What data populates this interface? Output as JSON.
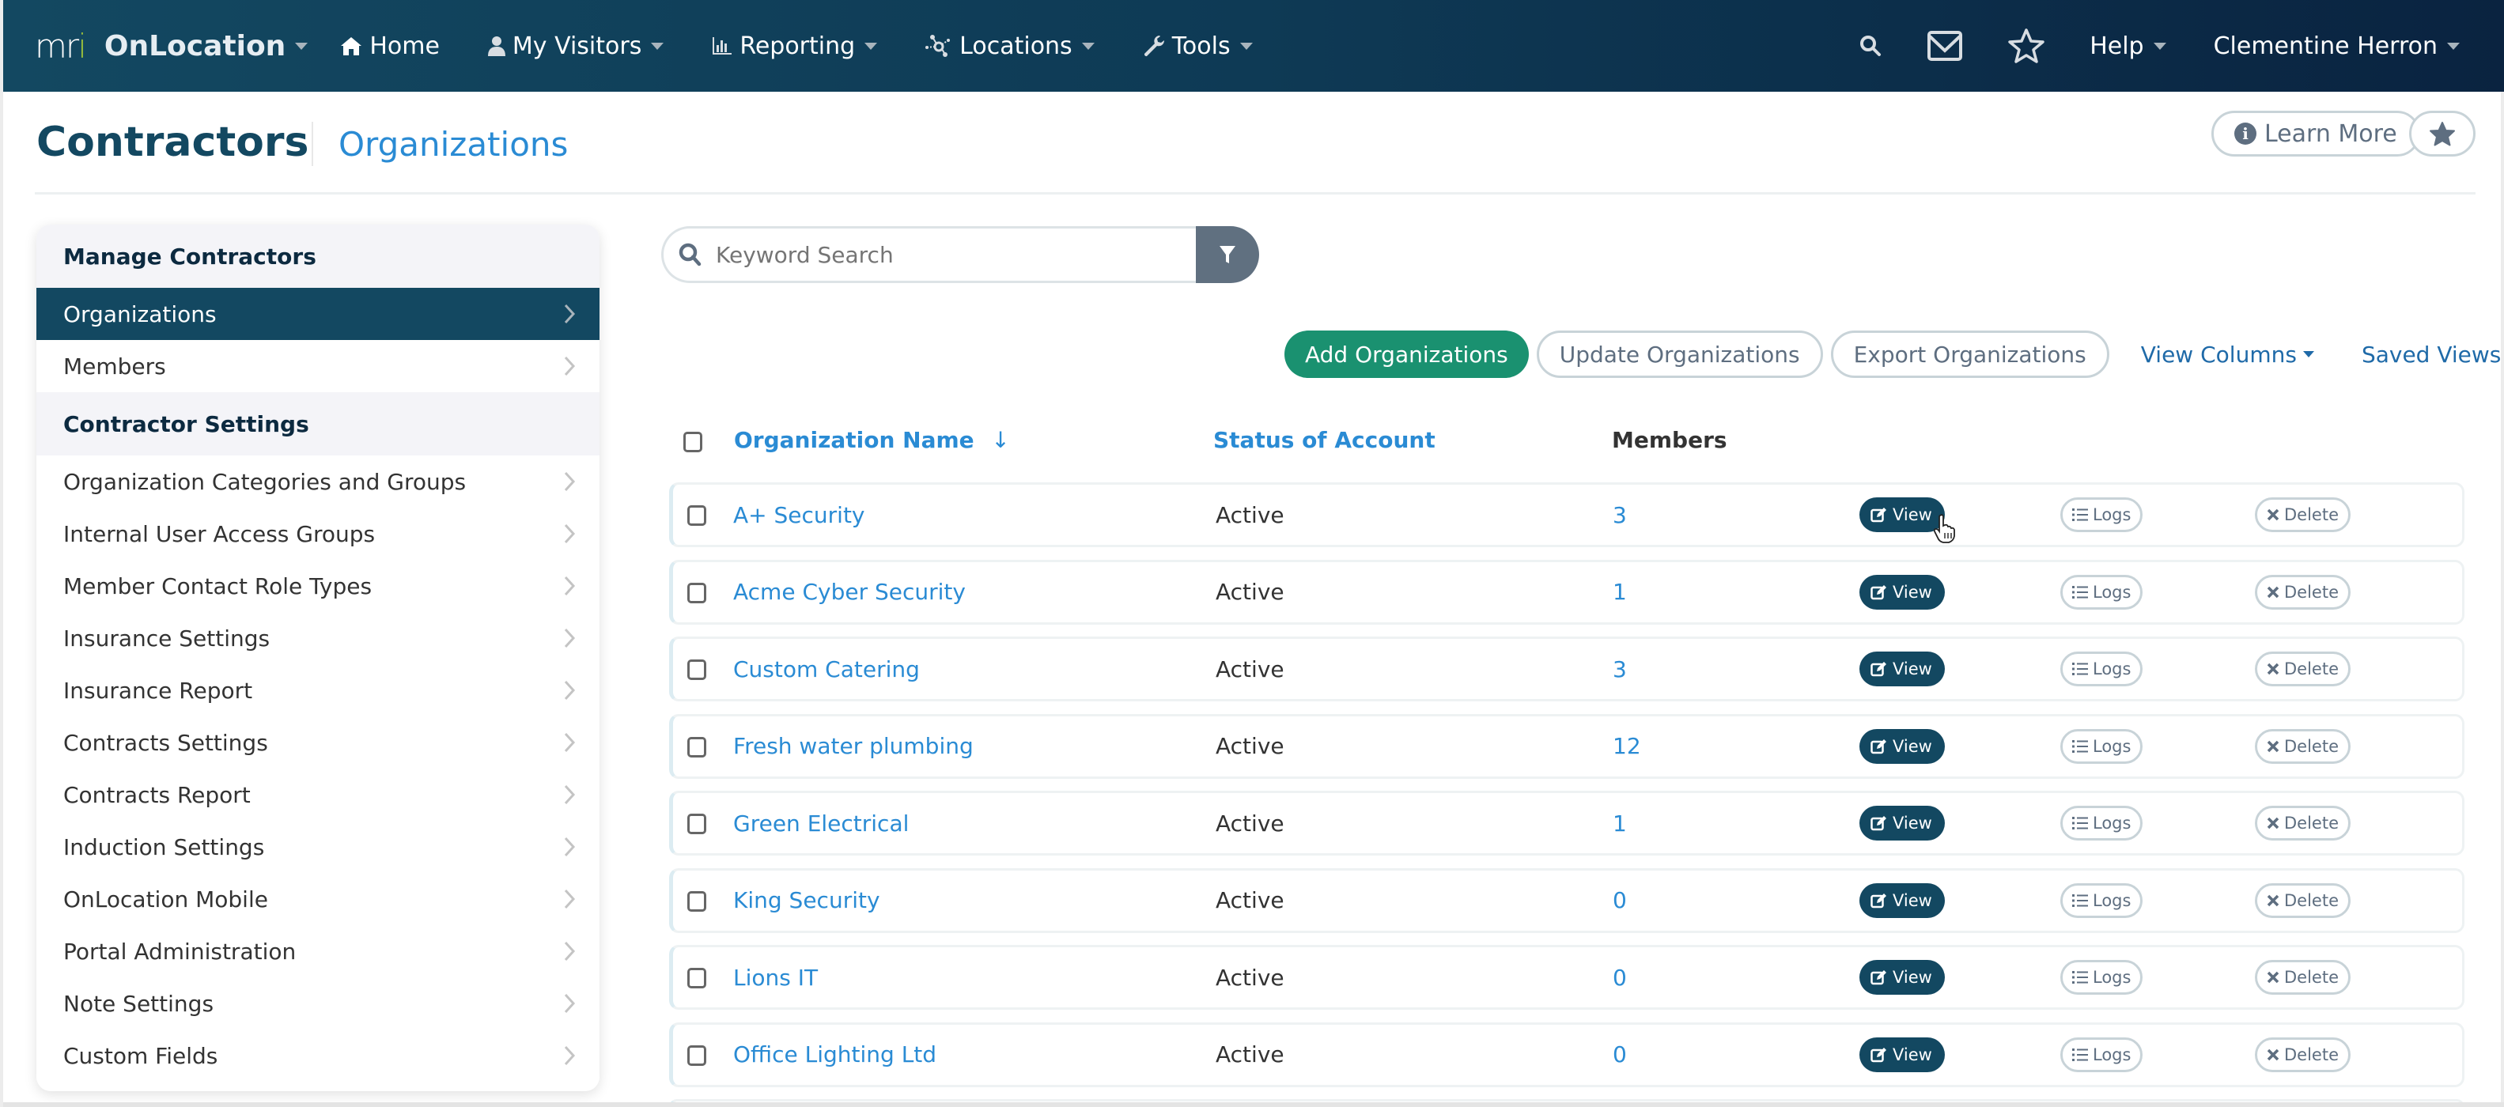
{
  "topnav": {
    "brand_logo": "mri",
    "brand_name": "OnLocation",
    "items": [
      {
        "label": "Home",
        "icon": "home-icon",
        "has_caret": false
      },
      {
        "label": "My Visitors",
        "icon": "user-icon",
        "has_caret": true
      },
      {
        "label": "Reporting",
        "icon": "bar-chart-icon",
        "has_caret": true
      },
      {
        "label": "Locations",
        "icon": "network-icon",
        "has_caret": true
      },
      {
        "label": "Tools",
        "icon": "wrench-icon",
        "has_caret": true
      }
    ],
    "help_label": "Help",
    "user_name": "Clementine Herron"
  },
  "header": {
    "title": "Contractors",
    "subtitle": "Organizations",
    "learn_more_label": "Learn More",
    "info_glyph": "i"
  },
  "sidebar": {
    "section1_title": "Manage Contractors",
    "section1_items": [
      {
        "label": "Organizations",
        "active": true
      },
      {
        "label": "Members",
        "active": false
      }
    ],
    "section2_title": "Contractor Settings",
    "section2_items": [
      {
        "label": "Organization Categories and Groups"
      },
      {
        "label": "Internal User Access Groups"
      },
      {
        "label": "Member Contact Role Types"
      },
      {
        "label": "Insurance Settings"
      },
      {
        "label": "Insurance Report"
      },
      {
        "label": "Contracts Settings"
      },
      {
        "label": "Contracts Report"
      },
      {
        "label": "Induction Settings"
      },
      {
        "label": "OnLocation Mobile"
      },
      {
        "label": "Portal Administration"
      },
      {
        "label": "Note Settings"
      },
      {
        "label": "Custom Fields"
      }
    ]
  },
  "search": {
    "placeholder": "Keyword Search",
    "value": ""
  },
  "actions": {
    "add_label": "Add Organizations",
    "update_label": "Update Organizations",
    "export_label": "Export Organizations",
    "view_columns_label": "View Columns",
    "saved_views_label": "Saved Views"
  },
  "table": {
    "columns": {
      "name": "Organization Name",
      "sort_indicator": "↓",
      "status": "Status of Account",
      "members": "Members"
    },
    "row_actions": {
      "view": "View",
      "logs": "Logs",
      "delete": "Delete"
    },
    "rows": [
      {
        "name": "A+ Security",
        "status": "Active",
        "members": "3"
      },
      {
        "name": "Acme Cyber Security",
        "status": "Active",
        "members": "1"
      },
      {
        "name": "Custom Catering",
        "status": "Active",
        "members": "3"
      },
      {
        "name": "Fresh water plumbing",
        "status": "Active",
        "members": "12"
      },
      {
        "name": "Green Electrical",
        "status": "Active",
        "members": "1"
      },
      {
        "name": "King Security",
        "status": "Active",
        "members": "0"
      },
      {
        "name": "Lions IT",
        "status": "Active",
        "members": "0"
      },
      {
        "name": "Office Lighting Ltd",
        "status": "Active",
        "members": "0"
      }
    ]
  },
  "colors": {
    "nav_bg": "#134861",
    "primary_dark": "#134861",
    "link_blue": "#2a8bd4",
    "add_green": "#1a9170",
    "logo_green": "#9cc13b",
    "muted_gray": "#5e6e80"
  }
}
